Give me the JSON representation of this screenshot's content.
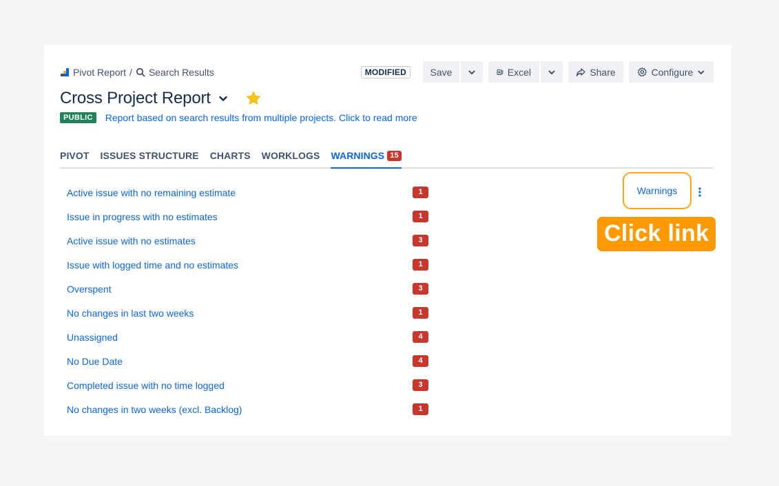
{
  "breadcrumb": {
    "root": "Pivot Report",
    "separator": "/",
    "current": "Search Results",
    "root_icon": "pivot-report-icon",
    "current_icon": "search-icon"
  },
  "toolbar": {
    "status": "MODIFIED",
    "save_label": "Save",
    "excel_label": "Excel",
    "share_label": "Share",
    "configure_label": "Configure"
  },
  "title": {
    "text": "Cross Project Report",
    "favorite": true
  },
  "description": {
    "badge": "PUBLIC",
    "text": "Report based on search results from multiple projects. Click to read more"
  },
  "tabs": [
    {
      "label": "PIVOT",
      "active": false
    },
    {
      "label": "ISSUES STRUCTURE",
      "active": false
    },
    {
      "label": "CHARTS",
      "active": false
    },
    {
      "label": "WORKLOGS",
      "active": false
    },
    {
      "label": "WARNINGS",
      "active": true,
      "count": "15"
    }
  ],
  "warnings": [
    {
      "label": "Active issue with no remaining estimate",
      "count": "1"
    },
    {
      "label": "Issue in progress with no estimates",
      "count": "1"
    },
    {
      "label": "Active issue with no estimates",
      "count": "3"
    },
    {
      "label": "Issue with logged time and no estimates",
      "count": "1"
    },
    {
      "label": "Overspent",
      "count": "3"
    },
    {
      "label": "No changes in last two weeks",
      "count": "1"
    },
    {
      "label": "Unassigned",
      "count": "4"
    },
    {
      "label": "No Due Date",
      "count": "4"
    },
    {
      "label": "Completed issue with no time logged",
      "count": "3"
    },
    {
      "label": "No changes in two weeks (excl. Backlog)",
      "count": "1"
    }
  ],
  "side": {
    "warnings_link": "Warnings",
    "callout": "Click link"
  },
  "colors": {
    "link": "#0c66e4",
    "badge_red": "#c9372c",
    "public_green": "#1f845a",
    "callout_orange": "#ff9900",
    "highlight_border": "#ffa41b",
    "star": "#f5c518"
  }
}
